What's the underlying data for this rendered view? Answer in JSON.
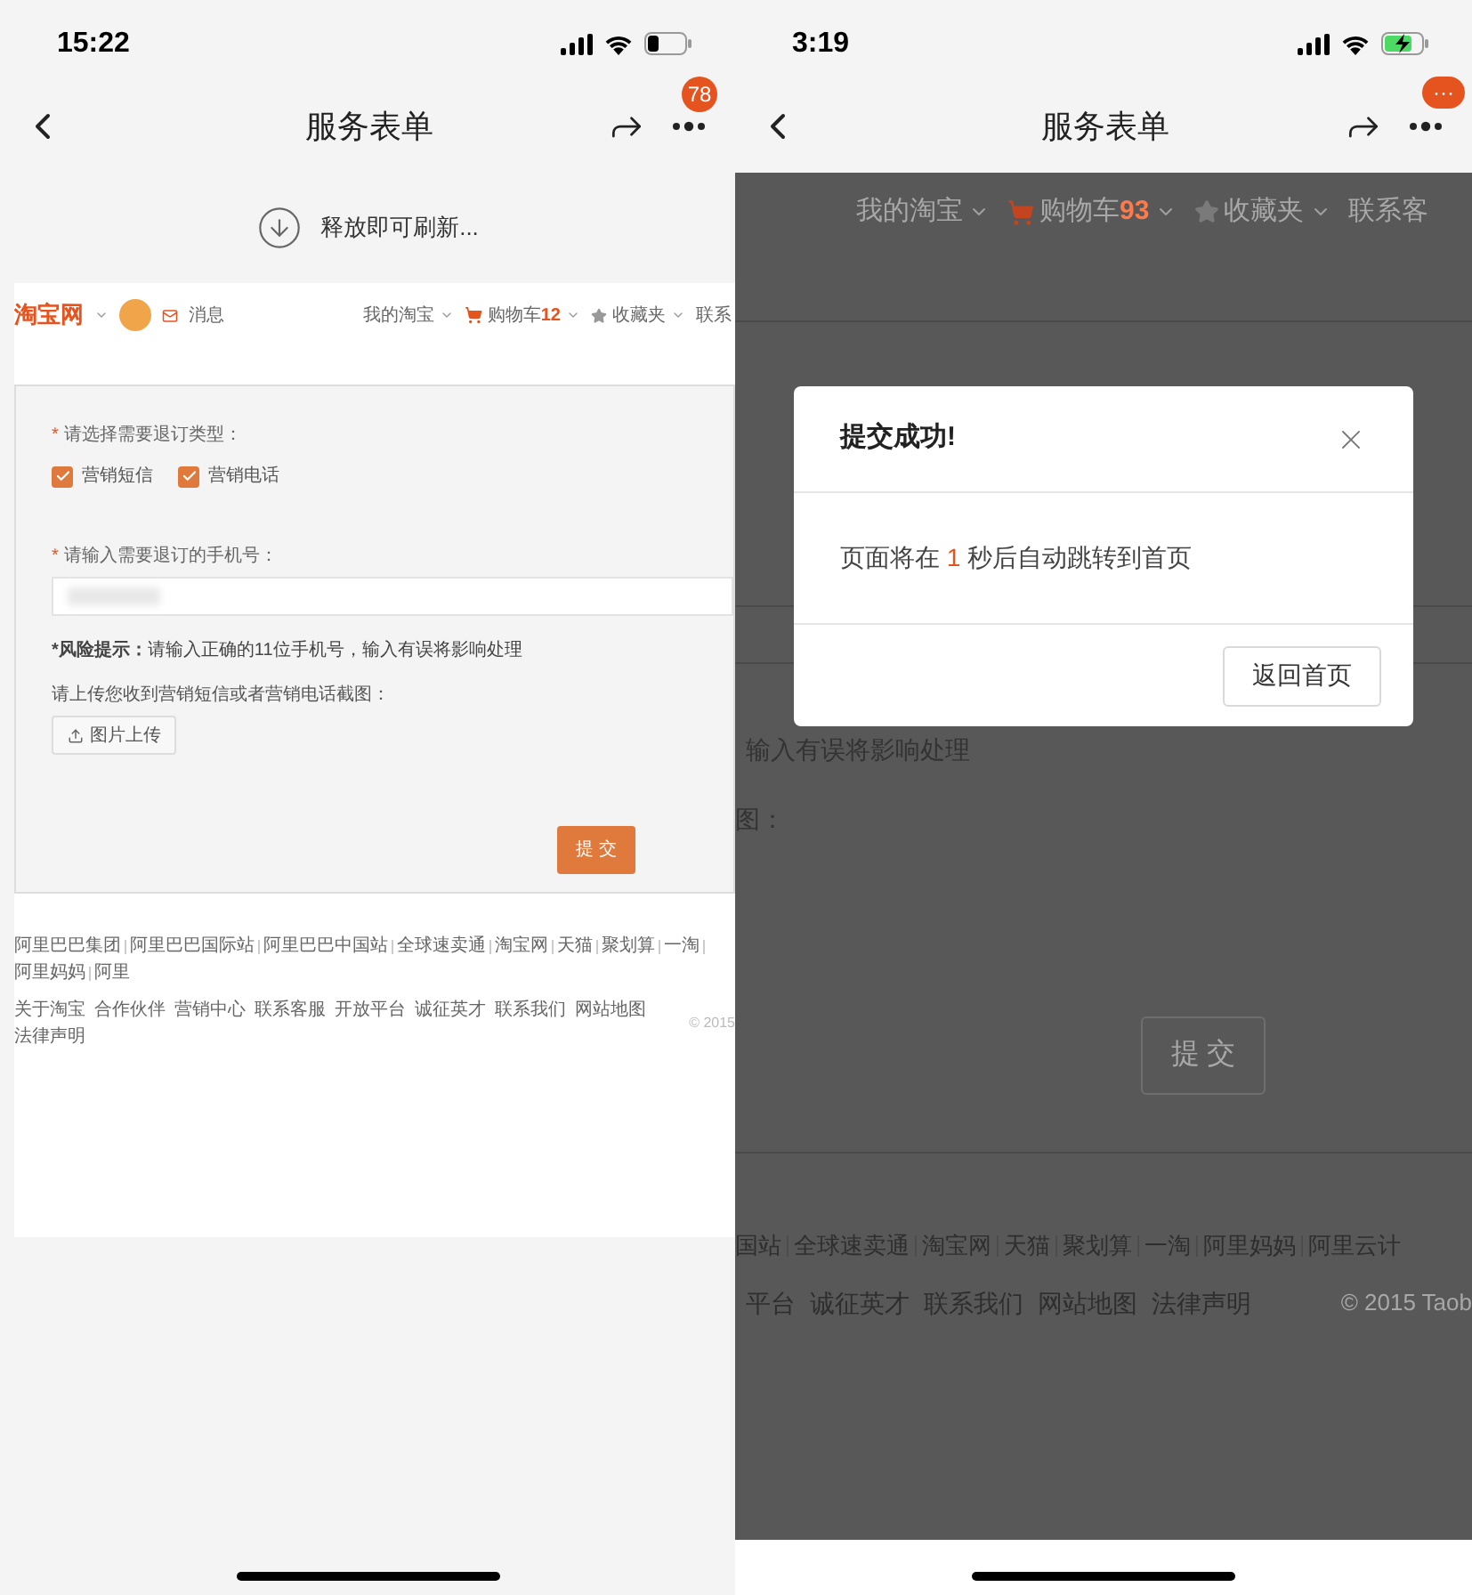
{
  "left_screen": {
    "status_bar": {
      "time": "15:22",
      "charging": false
    },
    "nav_bar": {
      "title": "服务表单",
      "menu_badge": "78"
    },
    "refresh_hint": "释放即可刷新...",
    "site_header": {
      "logo": "淘宝网",
      "messages": "消息",
      "links": [
        {
          "kind": "plain",
          "label": "我的淘宝",
          "dropdown": true
        },
        {
          "kind": "cart",
          "label": "购物车",
          "count": "12",
          "dropdown": true
        },
        {
          "kind": "star",
          "label": "收藏夹",
          "dropdown": true
        },
        {
          "kind": "plain",
          "label": "联系",
          "dropdown": false
        }
      ]
    },
    "form": {
      "required_mark": "*",
      "type_label": "请选择需要退订类型：",
      "options": [
        {
          "label": "营销短信",
          "checked": true
        },
        {
          "label": "营销电话",
          "checked": true
        }
      ],
      "phone_label": "请输入需要退订的手机号：",
      "risk_title": "*风险提示：",
      "risk_text": "请输入正确的11位手机号，输入有误将影响处理",
      "upload_label": "请上传您收到营销短信或者营销电话截图：",
      "upload_button": "图片上传",
      "submit": "提 交"
    },
    "footer": {
      "links": [
        "阿里巴巴集团",
        "阿里巴巴国际站",
        "阿里巴巴中国站",
        "全球速卖通",
        "淘宝网",
        "天猫",
        "聚划算",
        "一淘",
        "阿里妈妈",
        "阿里"
      ],
      "about_links": [
        "关于淘宝",
        "合作伙伴",
        "营销中心",
        "联系客服",
        "开放平台",
        "诚征英才",
        "联系我们",
        "网站地图",
        "法律声明"
      ],
      "copyright": "© 2015"
    }
  },
  "right_screen": {
    "status_bar": {
      "time": "3:19",
      "charging": true
    },
    "nav_bar": {
      "title": "服务表单",
      "menu_badge": "···"
    },
    "site_header": {
      "links": [
        {
          "kind": "plain",
          "label": "我的淘宝",
          "dropdown": true
        },
        {
          "kind": "cart",
          "label": "购物车",
          "count": "93",
          "dropdown": true
        },
        {
          "kind": "star",
          "label": "收藏夹",
          "dropdown": true
        },
        {
          "kind": "plain",
          "label": "联系客",
          "dropdown": false
        }
      ]
    },
    "form_fragments": [
      "输入有误将影响处理",
      "图："
    ],
    "submit": "提 交",
    "footer": {
      "links": [
        "国站",
        "全球速卖通",
        "淘宝网",
        "天猫",
        "聚划算",
        "一淘",
        "阿里妈妈",
        "阿里云计"
      ],
      "about_links": [
        "平台",
        "诚征英才",
        "联系我们",
        "网站地图",
        "法律声明"
      ],
      "copyright": "© 2015 Taob"
    },
    "dialog": {
      "title": "提交成功!",
      "message_before": "页面将在",
      "countdown": "1",
      "message_after": "秒后自动跳转到首页",
      "button": "返回首页"
    }
  }
}
